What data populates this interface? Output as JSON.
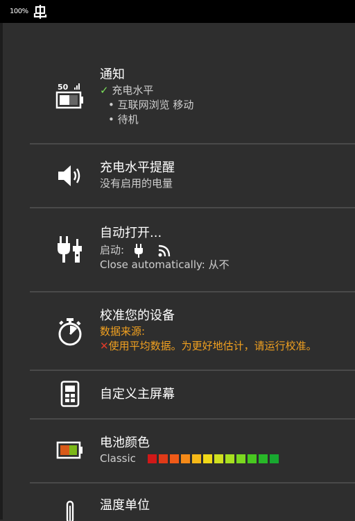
{
  "statusbar": {
    "battery_percent": "100%"
  },
  "settings": {
    "notification": {
      "title": "通知",
      "icon_label": "50",
      "checked_item": "充电水平",
      "bullets": [
        "互联网浏览 移动",
        "待机"
      ]
    },
    "charge_alert": {
      "title": "充电水平提醒",
      "subtitle": "没有启用的电量"
    },
    "auto_open": {
      "title": "自动打开...",
      "start_label": "启动:",
      "close_line": "Close automatically: 从不"
    },
    "calibrate": {
      "title": "校准您的设备",
      "source_label": "数据来源:",
      "warning": "使用平均数据。为更好地估计，请运行校准。"
    },
    "home_screen": {
      "title": "自定义主屏幕"
    },
    "battery_color": {
      "title": "电池颜色",
      "scheme_name": "Classic",
      "swatches": [
        "#d01818",
        "#e03a18",
        "#f05a18",
        "#f58a18",
        "#f5b818",
        "#f0d818",
        "#d0e020",
        "#a8e020",
        "#7cd820",
        "#48c820",
        "#28b828",
        "#18a830"
      ]
    },
    "temperature": {
      "title": "温度单位"
    }
  }
}
